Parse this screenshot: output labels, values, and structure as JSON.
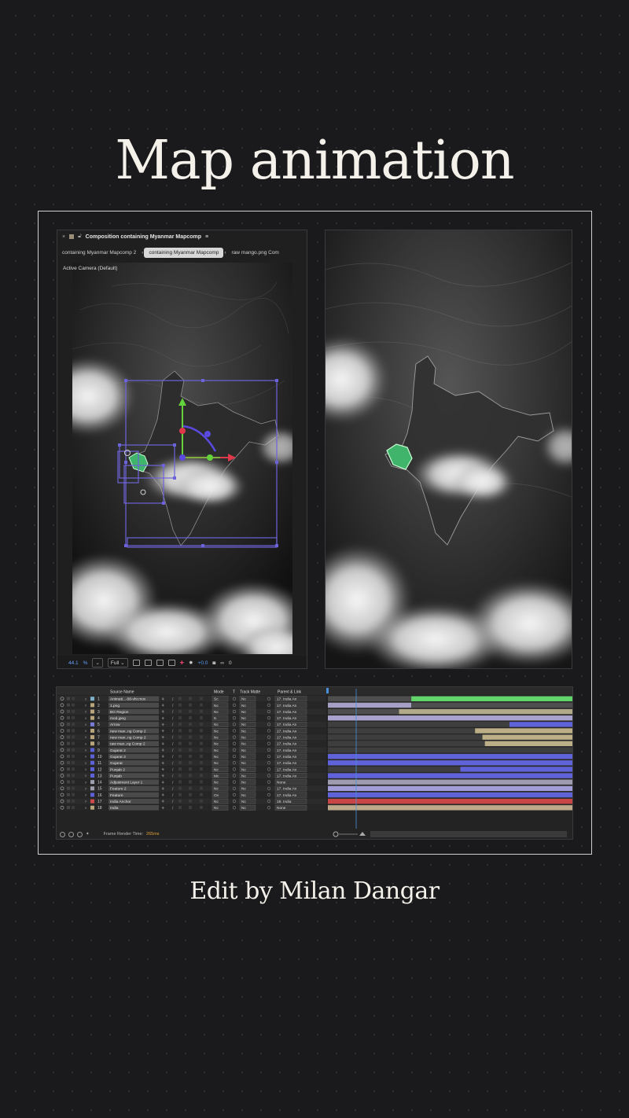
{
  "title": "Map animation",
  "credit": "Edit by Milan Dangar",
  "composition_panel": {
    "header_title": "Composition containing Myanmar Mapcomp",
    "tabs": [
      {
        "label": "containing Myanmar Mapcomp 2",
        "active": false
      },
      {
        "label": "containing Myanmar Mapcomp",
        "active": true
      },
      {
        "label": "raw mango.png Com",
        "active": false
      }
    ],
    "camera_label": "Active Camera (Default)",
    "footer": {
      "zoom": "44.1",
      "zoom_unit": "%",
      "resolution": "Full",
      "exposure": "+0.0",
      "last_value": "0"
    }
  },
  "timeline": {
    "columns": {
      "source_name": "Source Name",
      "mode": "Mode",
      "t": "T",
      "track_matte": "Track Matte",
      "parent_link": "Parent & Link"
    },
    "layers": [
      {
        "num": "1",
        "name": "Animati...-08-vhr.mov",
        "label_color": "#7fb0c9",
        "mode": "Sc",
        "matte": "Nc",
        "parent": "17. India An",
        "bar": {
          "start": 0.34,
          "end": 1.0,
          "color": "#62d66a"
        },
        "bar2": {
          "start": 0.0,
          "end": 0.34,
          "color": "#4e4e4e"
        }
      },
      {
        "num": "2",
        "name": "1.png",
        "label_color": "#b9a57b",
        "mode": "Nc",
        "matte": "Nc",
        "parent": "17. India An",
        "bar": {
          "start": 0.0,
          "end": 0.34,
          "color": "#a7a0c6"
        },
        "bar2": {
          "start": 0.34,
          "end": 1.0,
          "color": "#4e4e4e"
        }
      },
      {
        "num": "3",
        "name": "BG Region",
        "label_color": "#b9a57b",
        "mode": "Nc",
        "matte": "Nc",
        "parent": "17. India An",
        "bar": {
          "start": 0.0,
          "end": 0.29,
          "color": "#4e4e4e"
        },
        "bar2": {
          "start": 0.29,
          "end": 1.0,
          "color": "#b2a98a"
        }
      },
      {
        "num": "4",
        "name": "mod.jpeg",
        "label_color": "#b9a57b",
        "mode": "9.",
        "matte": "Nc",
        "parent": "17. India An",
        "bar": {
          "start": 0.0,
          "end": 1.0,
          "color": "#a9a2cc"
        },
        "bar2": null
      },
      {
        "num": "5",
        "name": "Arrow",
        "label_color": "#7a7bd8",
        "mode": "Nc",
        "matte": "Nc",
        "parent": "17. India An",
        "bar": {
          "start": 0.0,
          "end": 0.74,
          "color": "#3e3e3e"
        },
        "bar2": {
          "start": 0.74,
          "end": 1.0,
          "color": "#5f62d9"
        }
      },
      {
        "num": "6",
        "name": "new man..ng Comp 2",
        "label_color": "#b9a57b",
        "mode": "Nc",
        "matte": "Nc",
        "parent": "17. India An",
        "bar": {
          "start": 0.0,
          "end": 0.6,
          "color": "#3e3e3e"
        },
        "bar2": {
          "start": 0.6,
          "end": 1.0,
          "color": "#bcae86"
        }
      },
      {
        "num": "7",
        "name": "new man..ng Comp 2",
        "label_color": "#b9a57b",
        "mode": "Nc",
        "matte": "Nc",
        "parent": "17. India An",
        "bar": {
          "start": 0.0,
          "end": 0.63,
          "color": "#3e3e3e"
        },
        "bar2": {
          "start": 0.63,
          "end": 1.0,
          "color": "#bcae86"
        }
      },
      {
        "num": "8",
        "name": "raw man..ng Comp 2",
        "label_color": "#b9a57b",
        "mode": "Nc",
        "matte": "Nc",
        "parent": "17. India An",
        "bar": {
          "start": 0.0,
          "end": 0.64,
          "color": "#3e3e3e"
        },
        "bar2": {
          "start": 0.64,
          "end": 1.0,
          "color": "#bcae86"
        }
      },
      {
        "num": "9",
        "name": "Gujarat 2",
        "label_color": "#5c61d8",
        "mode": "Nc",
        "matte": "Nc",
        "parent": "17. India An",
        "bar": {
          "start": 0.0,
          "end": 1.0,
          "color": "#3e3e3e"
        },
        "bar2": null
      },
      {
        "num": "10",
        "name": "Gujarat 3",
        "label_color": "#5c61d8",
        "mode": "Nc",
        "matte": "Nc",
        "parent": "17. India An",
        "bar": {
          "start": 0.0,
          "end": 1.0,
          "color": "#5f62d9"
        },
        "bar2": null
      },
      {
        "num": "11",
        "name": "Gujarat",
        "label_color": "#5c61d8",
        "mode": "Nc",
        "matte": "Nc",
        "parent": "17. India An",
        "bar": {
          "start": 0.0,
          "end": 1.0,
          "color": "#5f62d9"
        },
        "bar2": null
      },
      {
        "num": "12",
        "name": "Punjab 2",
        "label_color": "#5c61d8",
        "mode": "Nc",
        "matte": "Nc",
        "parent": "17. India An",
        "bar": {
          "start": 0.0,
          "end": 0.54,
          "color": "#3e3e3e"
        },
        "bar2": {
          "start": 0.54,
          "end": 1.0,
          "color": "#5f62d9"
        }
      },
      {
        "num": "13",
        "name": "Punjab",
        "label_color": "#5c61d8",
        "mode": "Mc",
        "matte": "Nc",
        "parent": "17. India An",
        "bar": {
          "start": 0.0,
          "end": 1.0,
          "color": "#5f62d9"
        },
        "bar2": null
      },
      {
        "num": "14",
        "name": "Adjustment Layer 1",
        "label_color": "#9ea0ad",
        "mode": "Nc",
        "matte": "Nc",
        "parent": "None",
        "bar": {
          "start": 0.0,
          "end": 1.0,
          "color": "#9d9bad"
        },
        "bar2": null
      },
      {
        "num": "15",
        "name": "Feature 2",
        "label_color": "#9ea0ad",
        "mode": "Nc",
        "matte": "Nc",
        "parent": "17. India An",
        "bar": {
          "start": 0.0,
          "end": 1.0,
          "color": "#a29dd8"
        },
        "bar2": null
      },
      {
        "num": "16",
        "name": "Feature",
        "label_color": "#5c61d8",
        "mode": "Ov",
        "matte": "Nc",
        "parent": "17. India An",
        "bar": {
          "start": 0.0,
          "end": 1.0,
          "color": "#5f62d9"
        },
        "bar2": null
      },
      {
        "num": "17",
        "name": "India Anchor",
        "label_color": "#d34a4a",
        "mode": "Nc",
        "matte": "Nc",
        "parent": "18. India",
        "bar": {
          "start": 0.0,
          "end": 1.0,
          "color": "#c84646"
        },
        "bar2": null
      },
      {
        "num": "18",
        "name": "India",
        "label_color": "#b9a57b",
        "mode": "Nc",
        "matte": "Nc",
        "parent": "None",
        "bar": {
          "start": 0.0,
          "end": 1.0,
          "color": "#bda98a"
        },
        "bar2": null
      }
    ],
    "footer": {
      "render_time_label": "Frame Render Time:",
      "render_time_value": "265ms"
    }
  },
  "colors": {
    "background": "#1a191b",
    "frame_border": "#cfcfcf",
    "text_light": "#f4f1ea",
    "selection_purple": "#6d63d8",
    "gizmo_green": "#64d23a",
    "gizmo_red": "#e0384b",
    "shape_green": "#3fb46a",
    "playhead_blue": "#4a90d9"
  }
}
